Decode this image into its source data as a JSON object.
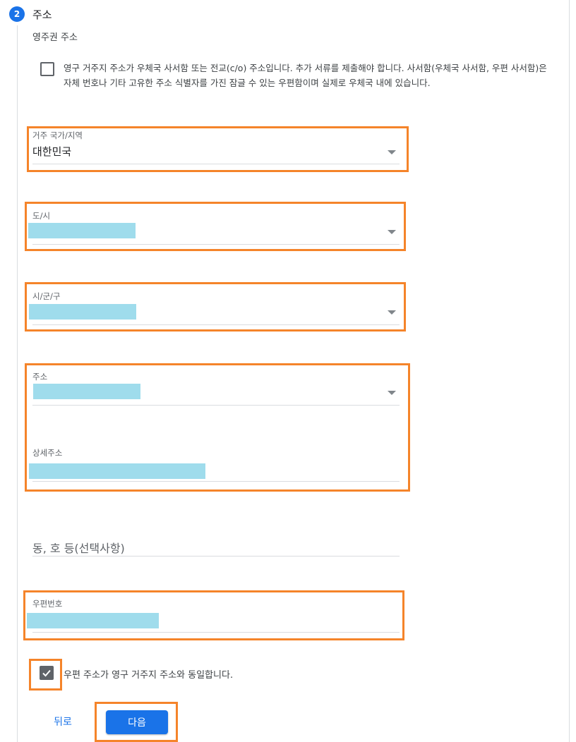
{
  "step": {
    "number": "2",
    "title": "주소"
  },
  "section": {
    "label": "영주권 주소"
  },
  "po_box_checkbox": {
    "checked": false,
    "text": "영구 거주지 주소가 우체국 사서함 또는 전교(c/o) 주소입니다. 추가 서류를 제출해야 합니다. 사서함(우체국 사서함, 우편 사서함)은 자체 번호나 기타 고유한 주소 식별자를 가진 잠글 수 있는 우편함이며 실제로 우체국 내에 있습니다."
  },
  "fields": {
    "country": {
      "label": "거주 국가/지역",
      "value": "대한민국"
    },
    "province": {
      "label": "도/시",
      "value": ""
    },
    "city": {
      "label": "시/군/구",
      "value": ""
    },
    "address": {
      "label": "주소",
      "value": ""
    },
    "detail_address": {
      "label": "상세주소",
      "value": ""
    },
    "optional": {
      "placeholder": "동, 호 등(선택사항)"
    },
    "postal": {
      "label": "우편번호",
      "value": ""
    }
  },
  "same_address_checkbox": {
    "checked": true,
    "text": "우편 주소가 영구 거주지 주소와 동일합니다."
  },
  "buttons": {
    "back": "뒤로",
    "next": "다음"
  },
  "colors": {
    "accent": "#1a73e8",
    "highlight": "#f5842a",
    "redaction": "#9fdcec"
  }
}
